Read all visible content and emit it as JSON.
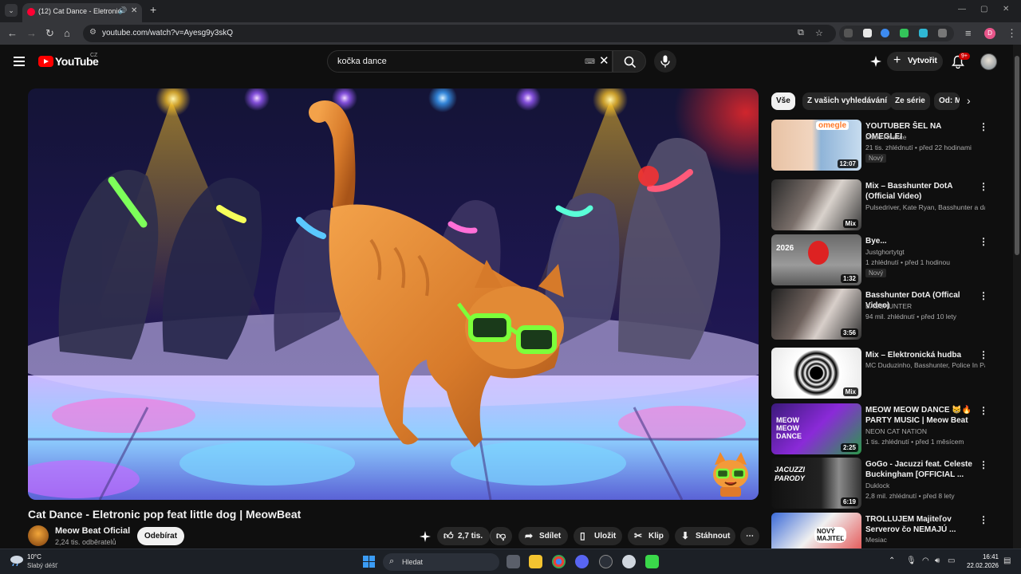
{
  "browser": {
    "tab_title": "(12) Cat Dance - Eletronic p",
    "url": "youtube.com/watch?v=Ayesg9y3skQ",
    "profile_letter": "D"
  },
  "masthead": {
    "logo_text": "YouTube",
    "country_code": "CZ",
    "search_value": "kočka dance",
    "create_label": "Vytvořit",
    "notification_count": "9+"
  },
  "video": {
    "title": "Cat Dance - Eletronic pop feat little dog | MeowBeat",
    "channel_name": "Meow Beat Oficial",
    "subscribers": "2,24 tis. odběratelů",
    "subscribe_label": "Odebírat",
    "like_count": "2,7 tis.",
    "share_label": "Sdílet",
    "save_label": "Uložit",
    "clip_label": "Klip",
    "download_label": "Stáhnout"
  },
  "chips": [
    "Vše",
    "Z vašich vyhledávání",
    "Ze série",
    "Od: M"
  ],
  "recommendations": [
    {
      "title": "YOUTUBER ŠEL NA OMEGLEI",
      "channel": "Dodo Reakce",
      "meta": "21 tis. zhlédnutí • před 22 hodinami",
      "badge": "Nový",
      "duration": "12:07",
      "thumb_text": "omegle"
    },
    {
      "title": "Mix – Basshunter DotA (Official Video)",
      "channel": "Pulsedriver, Kate Ryan, Basshunter a další",
      "meta": "",
      "badge": "",
      "duration": "Mix",
      "thumb_text": ""
    },
    {
      "title": "Bye...",
      "channel": "Justghortytgt",
      "meta": "1 zhlédnutí • před 1 hodinou",
      "badge": "Nový",
      "duration": "1:32",
      "thumb_text": "2026"
    },
    {
      "title": "Basshunter DotA (Offical Video)",
      "channel": "BASSHUNTER",
      "meta": "94 mil. zhlédnutí • před 10 lety",
      "badge": "",
      "duration": "3:56",
      "thumb_text": ""
    },
    {
      "title": "Mix – Elektronická hudba",
      "channel": "MC Duduzinho, Basshunter, Police In Par...",
      "meta": "",
      "badge": "",
      "duration": "Mix",
      "thumb_text": ""
    },
    {
      "title": "MEOW MEOW DANCE 😸🔥 PARTY MUSIC | Meow Beat",
      "channel": "NEON CAT NATION",
      "meta": "1 tis. zhlédnutí • před 1 měsícem",
      "badge": "",
      "duration": "2:25",
      "thumb_text": "MEOW MEOW DANCE"
    },
    {
      "title": "GoGo - Jacuzzi feat. Celeste Buckingham [OFFICIAL ...",
      "channel": "Duklock",
      "meta": "2,8 mil. zhlédnutí • před 8 lety",
      "badge": "",
      "duration": "6:19",
      "thumb_text": "JACUZZI PARODY"
    },
    {
      "title": "TROLLUJEM Majiteľov Serverov čo NEMAJÚ ...",
      "channel": "Mesiac",
      "meta": "",
      "badge": "",
      "duration": "",
      "thumb_text": "NOVÝ MAJITEĽ"
    }
  ],
  "taskbar": {
    "temperature": "10°C",
    "weather": "Slabý déšť",
    "search_label": "Hledat",
    "time": "16:41",
    "date": "22.02.2026"
  },
  "colors": {
    "yt_red": "#ff0000",
    "page_bg": "#0f0f0f",
    "chip_bg": "#272727"
  }
}
